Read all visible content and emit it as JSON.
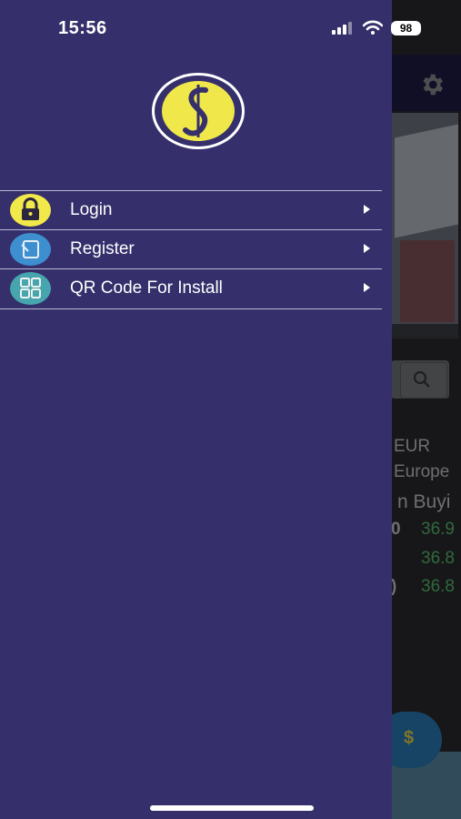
{
  "status_bar": {
    "time": "15:56",
    "battery": "98"
  },
  "drawer": {
    "menu": [
      {
        "label": "Login",
        "icon": "lock-icon",
        "color": "#f1e84a"
      },
      {
        "label": "Register",
        "icon": "register-icon",
        "color": "#3d8fd0"
      },
      {
        "label": "QR Code For Install",
        "icon": "grid-icon",
        "color": "#46a5ad"
      }
    ]
  },
  "background": {
    "currency_code": "EUR",
    "currency_name": "Europe",
    "column_label": "n Buyi",
    "rates": [
      "36.9",
      "36.8",
      "36.8"
    ],
    "rate_prefix": [
      "0",
      "",
      ")"
    ],
    "fab_label": "$"
  }
}
